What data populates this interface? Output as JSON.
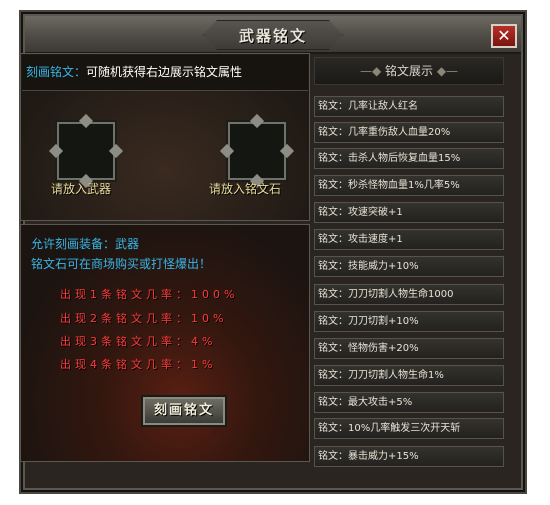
{
  "window": {
    "title": "武器铭文",
    "close_label": "✕"
  },
  "info": {
    "label": "刻画铭文：",
    "text": "可随机获得右边展示铭文属性"
  },
  "slots": {
    "weapon_label": "请放入武器",
    "stone_label": "请放入铭文石"
  },
  "allow": {
    "line1": "允许刻画装备：武器",
    "line2": "铭文石可在商场购买或打怪爆出！"
  },
  "rates": [
    "出现1条铭文几率：100%",
    "出现2条铭文几率：10%",
    "出现3条铭文几率：4%",
    "出现4条铭文几率：1%"
  ],
  "engrave_button": "刻画铭文",
  "display": {
    "header": "铭文展示",
    "prefix": "铭文：",
    "items": [
      "几率让敌人红名",
      "几率重伤敌人血量20%",
      "击杀人物后恢复血量15%",
      "秒杀怪物血量1%几率5%",
      "攻速突破+1",
      "攻击速度+1",
      "技能威力+10%",
      "刀刀切割人物生命1000",
      "刀刀切割+10%",
      "怪物伤害+20%",
      "刀刀切割人物生命1%",
      "最大攻击+5%",
      "10%几率触发三次开天斩",
      "暴击威力+15%"
    ]
  }
}
